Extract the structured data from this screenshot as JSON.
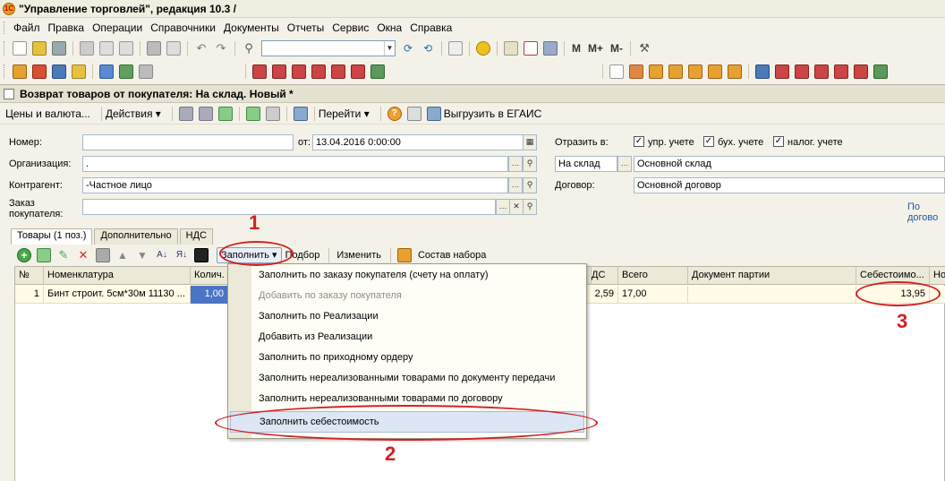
{
  "window": {
    "title": "\"Управление торговлей\", редакция 10.3 /"
  },
  "menu": [
    "Файл",
    "Правка",
    "Операции",
    "Справочники",
    "Документы",
    "Отчеты",
    "Сервис",
    "Окна",
    "Справка"
  ],
  "toolbar": {
    "m_buttons": [
      "M",
      "M+",
      "M-"
    ]
  },
  "document": {
    "title": "Возврат товаров от покупателя: На склад. Новый *",
    "toolbar": {
      "prices": "Цены и валюта...",
      "actions": "Действия ▾",
      "goto": "Перейти ▾",
      "egais": "Выгрузить в ЕГАИС"
    }
  },
  "form": {
    "number_label": "Номер:",
    "number_value": "",
    "from_label": "от:",
    "date_value": "13.04.2016  0:00:00",
    "org_label": "Организация:",
    "org_value": ".",
    "counterparty_label": "Контрагент:",
    "counterparty_value": "-Частное  лицо",
    "order_label_1": "Заказ",
    "order_label_2": "покупателя:",
    "order_value": "",
    "reflect_label": "Отразить в:",
    "chk_mgmt": "упр. учете",
    "chk_acc": "бух. учете",
    "chk_tax": "налог. учете",
    "warehouse_type": "На склад",
    "warehouse_value": "Основной склад",
    "contract_label": "Договор:",
    "contract_value": "Основной договор",
    "link": "По догово"
  },
  "tabs": [
    "Товары (1 поз.)",
    "Дополнительно",
    "НДС"
  ],
  "table_toolbar": {
    "fill": "Заполнить ▾",
    "pick": "Подбор",
    "change": "Изменить",
    "kit": "Состав набора"
  },
  "table": {
    "headers": [
      "№",
      "Номенклатура",
      "Колич.",
      "ДС",
      "Всего",
      "Документ партии",
      "Себестоимо...",
      "Но"
    ],
    "row": {
      "num": "1",
      "item": "Бинт строит. 5см*30м 11130 ...",
      "qty": "1,00",
      "vat": "2,59",
      "total": "17,00",
      "batch": "",
      "cost": "13,95"
    }
  },
  "dropdown": {
    "items": [
      {
        "label": "Заполнить по заказу покупателя (счету на оплату)",
        "disabled": false
      },
      {
        "label": "Добавить по заказу покупателя",
        "disabled": true
      },
      {
        "label": "Заполнить по Реализации",
        "disabled": false
      },
      {
        "label": "Добавить из Реализации",
        "disabled": false
      },
      {
        "label": "Заполнить по приходному ордеру",
        "disabled": false
      },
      {
        "label": "Заполнить нереализованными товарами по документу передачи",
        "disabled": false
      },
      {
        "label": "Заполнить нереализованными товарами по договору",
        "disabled": false
      },
      {
        "label": "Заполнить себестоимость",
        "disabled": false
      }
    ]
  },
  "annotations": {
    "n1": "1",
    "n2": "2",
    "n3": "3"
  },
  "colors": {
    "annotation": "#d42020",
    "highlight": "#dce6f4",
    "row_bg": "#fffbe6"
  }
}
